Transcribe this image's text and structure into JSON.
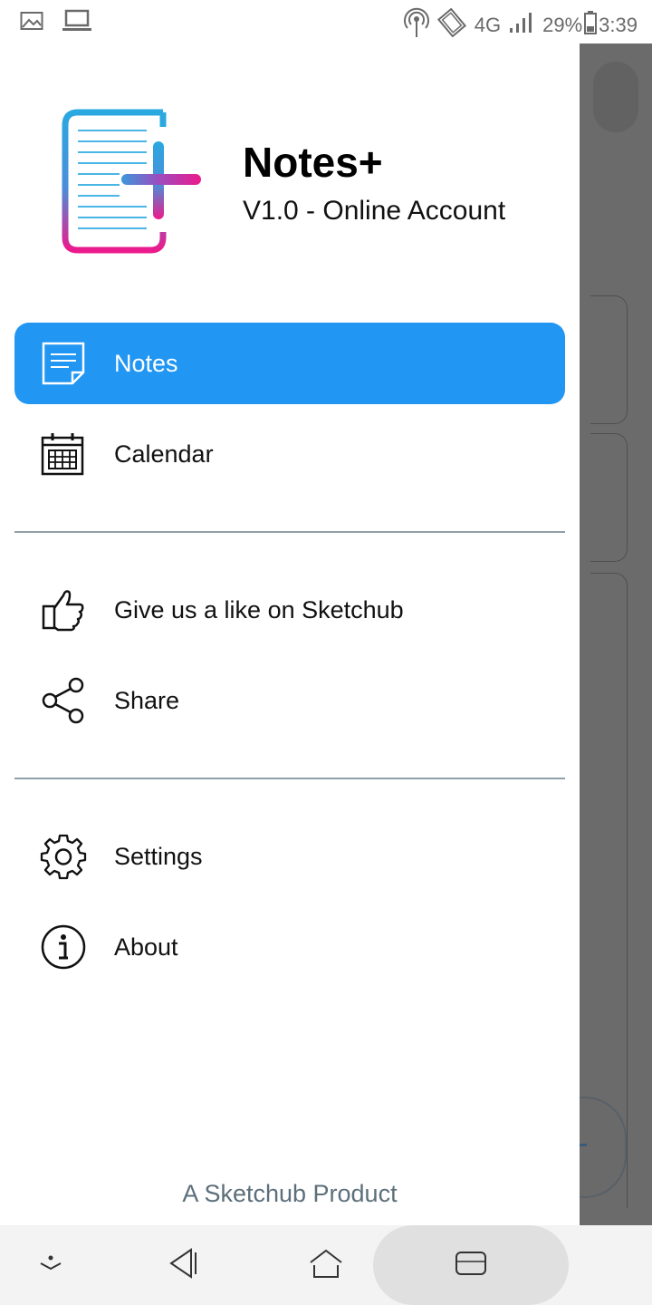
{
  "status_bar": {
    "network": "4G",
    "battery": "29%",
    "time": "3:39"
  },
  "drawer": {
    "app_name": "Notes+",
    "version": "V1.0 - Online Account",
    "items": [
      {
        "label": "Notes",
        "icon": "note-icon",
        "active": true
      },
      {
        "label": "Calendar",
        "icon": "calendar-icon",
        "active": false
      },
      {
        "label": "Give us a like on Sketchub",
        "icon": "thumbs-up-icon",
        "active": false
      },
      {
        "label": "Share",
        "icon": "share-icon",
        "active": false
      },
      {
        "label": "Settings",
        "icon": "gear-icon",
        "active": false
      },
      {
        "label": "About",
        "icon": "info-icon",
        "active": false
      }
    ],
    "footer": "A Sketchub Product"
  },
  "colors": {
    "accent": "#2196f3",
    "footer_text": "#5c6f7a",
    "divider": "#8fa0a8",
    "logo_blue": "#2aa8e0",
    "logo_pink": "#ec1a8c"
  }
}
